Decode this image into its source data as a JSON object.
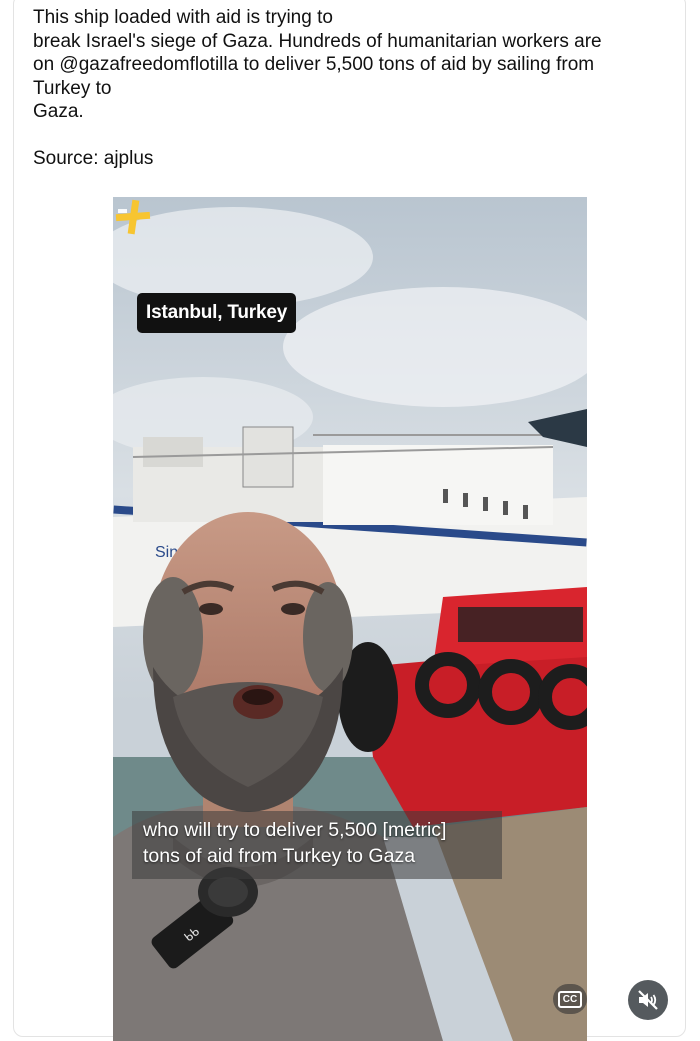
{
  "post": {
    "text": "This ship loaded with aid is trying to\nbreak Israel's siege of Gaza. Hundreds of humanitarian workers are\non @gazafreedomflotilla to deliver 5,500 tons of aid by sailing from\nTurkey to\nGaza.",
    "source": "Source: ajplus"
  },
  "video": {
    "location_label": "Istanbul, Turkey",
    "ship_name": "Sina",
    "caption_line1": "who will try to deliver 5,500 [metric]",
    "caption_line2": "tons of aid from Turkey to Gaza",
    "cc_label": "CC"
  },
  "icons": {
    "brand": "ajplus-logo",
    "cc": "closed-captions-icon",
    "mute": "speaker-muted-icon"
  },
  "colors": {
    "logo_yellow": "#f7c531",
    "tugboat_red": "#c81e27"
  }
}
